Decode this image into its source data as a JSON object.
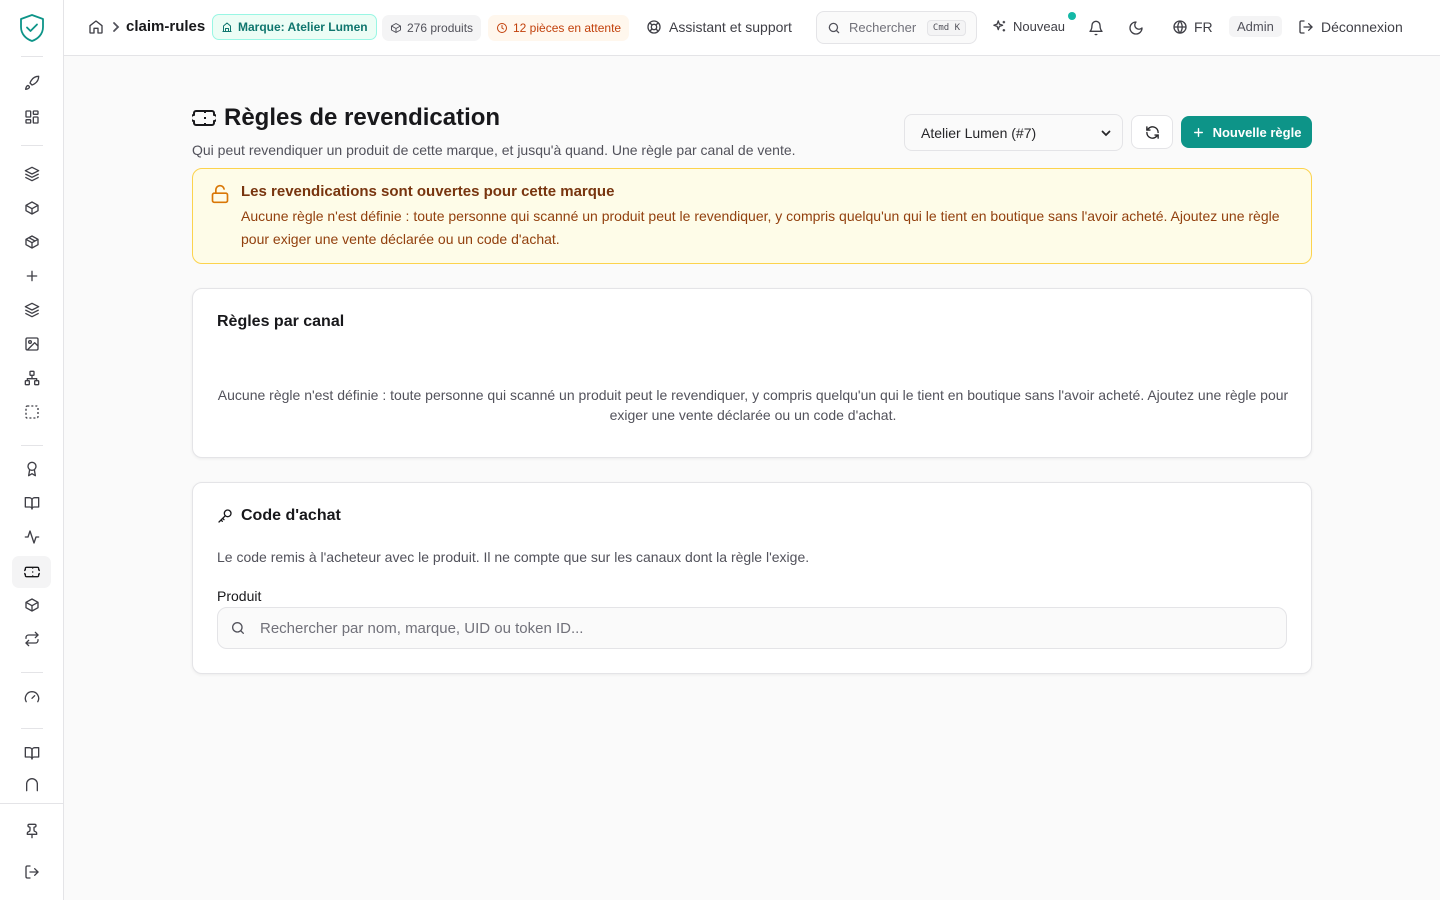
{
  "header": {
    "breadcrumb": "claim-rules",
    "brand_pill": "Marque: Atelier Lumen",
    "products_pill": "276 produits",
    "pending_pill": "12 pièces en attente",
    "support_label": "Assistant et support",
    "search_label": "Rechercher",
    "search_kbd": "Cmd K",
    "new_label": "Nouveau",
    "language": "FR",
    "role": "Admin",
    "logout_label": "Déconnexion"
  },
  "page": {
    "title": "Règles de revendication",
    "subtitle": "Qui peut revendiquer un produit de cette marque, et jusqu'à quand. Une règle par canal de vente.",
    "brand_selected": "Atelier Lumen (#7)",
    "new_rule_label": "Nouvelle règle"
  },
  "alert": {
    "title": "Les revendications sont ouvertes pour cette marque",
    "body": "Aucune règle n'est définie : toute personne qui scanné un produit peut le revendiquer, y compris quelqu'un qui le tient en boutique sans l'avoir acheté. Ajoutez une règle pour exiger une vente déclarée ou un code d'achat."
  },
  "rules_card": {
    "title": "Règles par canal",
    "empty": "Aucune règle n'est définie : toute personne qui scanné un produit peut le revendiquer, y compris quelqu'un qui le tient en boutique sans l'avoir acheté. Ajoutez une règle pour exiger une vente déclarée ou un code d'achat."
  },
  "code_card": {
    "title": "Code d'achat",
    "description": "Le code remis à l'acheteur avec le produit. Il ne compte que sur les canaux dont la règle l'exige.",
    "product_label": "Produit",
    "product_placeholder": "Rechercher par nom, marque, UID ou token ID..."
  },
  "colors": {
    "accent": "#0d9488",
    "alert_bg": "#fefce8",
    "alert_border": "#fcd34d"
  },
  "sidebar_icons": [
    "rocket-icon",
    "grid-icon",
    "layers-icon",
    "box-icon",
    "package-icon",
    "plus-icon",
    "layers-icon",
    "image-icon",
    "network-icon",
    "dashed-square-icon",
    "award-icon",
    "book-icon",
    "activity-icon",
    "ticket-icon",
    "package-check-icon",
    "repeat-icon",
    "gauge-icon",
    "book-icon",
    "arch-icon",
    "pin-icon",
    "logout-icon"
  ]
}
